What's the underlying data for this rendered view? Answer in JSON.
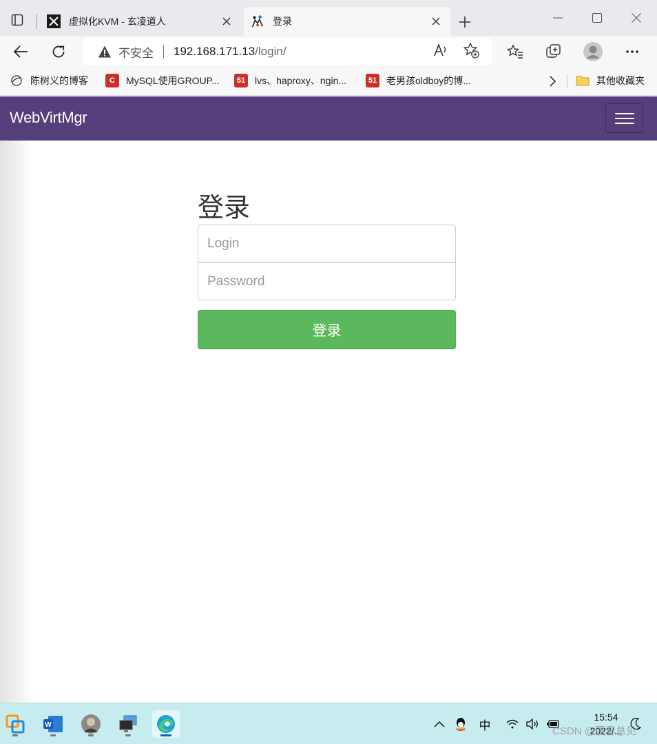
{
  "browser": {
    "tabs": [
      {
        "title": "虚拟化KVM - 玄凌道人",
        "active": false
      },
      {
        "title": "登录",
        "active": true
      }
    ],
    "address": {
      "security_label": "不安全",
      "url_host": "192.168.171.13",
      "url_path": "/login/"
    },
    "bookmarks": [
      {
        "label": "陈树义的博客",
        "icon": "globe-icon"
      },
      {
        "label": "MySQL使用GROUP...",
        "icon": "csdn-icon",
        "icon_text": "C",
        "color": "#c9302c"
      },
      {
        "label": "lvs、haproxy、ngin...",
        "icon": "51cto-icon",
        "icon_text": "51",
        "color": "#c9302c"
      },
      {
        "label": "老男孩oldboy的博...",
        "icon": "51cto-icon",
        "icon_text": "51",
        "color": "#c9302c"
      }
    ],
    "other_bookmarks": "其他收藏夹"
  },
  "app": {
    "brand": "WebVirtMgr",
    "navbar_color": "#563d7c"
  },
  "login": {
    "heading": "登录",
    "login_placeholder": "Login",
    "password_placeholder": "Password",
    "submit_label": "登录",
    "submit_color": "#5cb85c"
  },
  "taskbar": {
    "ime": "中",
    "time": "15:54",
    "date": "2022/...",
    "watermark": "CSDN @腰春总见"
  }
}
